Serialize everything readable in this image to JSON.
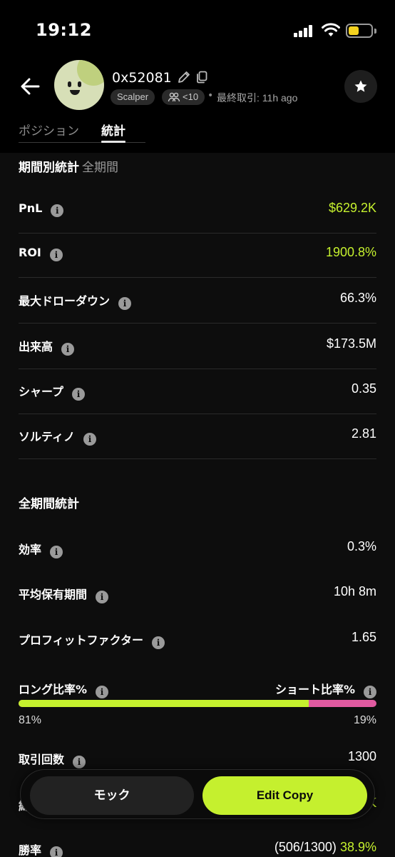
{
  "status_bar": {
    "time": "19:12"
  },
  "profile": {
    "address": "0x52081",
    "tag": "Scalper",
    "followers": "<10",
    "last_trade_label": "最終取引:",
    "last_trade_time": "11h ago"
  },
  "tabs": [
    {
      "label": "ポジション",
      "active": false
    },
    {
      "label": "統計",
      "active": true
    }
  ],
  "period_stats": {
    "title": "期間別統計",
    "period": "全期間",
    "rows": [
      {
        "label": "PnL",
        "value": "$629.2K",
        "highlight": true
      },
      {
        "label": "ROI",
        "value": "1900.8%",
        "highlight": true
      },
      {
        "label": "最大ドローダウン",
        "value": "66.3%"
      },
      {
        "label": "出来高",
        "value": "$173.5M"
      },
      {
        "label": "シャープ",
        "value": "0.35"
      },
      {
        "label": "ソルティノ",
        "value": "2.81"
      }
    ]
  },
  "all_time_stats": {
    "title": "全期間統計",
    "rows": [
      {
        "label": "効率",
        "value": "0.3%"
      },
      {
        "label": "平均保有期間",
        "value": "10h 8m"
      },
      {
        "label": "プロフィットファクター",
        "value": "1.65"
      }
    ],
    "ratio": {
      "long_label": "ロング比率%",
      "short_label": "ショート比率%",
      "long_pct": 81,
      "short_pct": 19,
      "long_text": "81%",
      "short_text": "19%"
    },
    "trade_count": {
      "label": "取引回数",
      "value": "1300"
    },
    "win_rate": {
      "label": "勝率",
      "detail": "(506/1300)",
      "value": "38.9%"
    }
  },
  "actions": {
    "mock_label": "モック",
    "edit_label": "Edit Copy"
  },
  "colors": {
    "accent": "#c5f02e",
    "short": "#e05aa0",
    "background": "#0d0d0d"
  },
  "icons": [
    "back-arrow-icon",
    "pencil-icon",
    "copy-icon",
    "users-icon",
    "star-icon",
    "info-icon"
  ]
}
